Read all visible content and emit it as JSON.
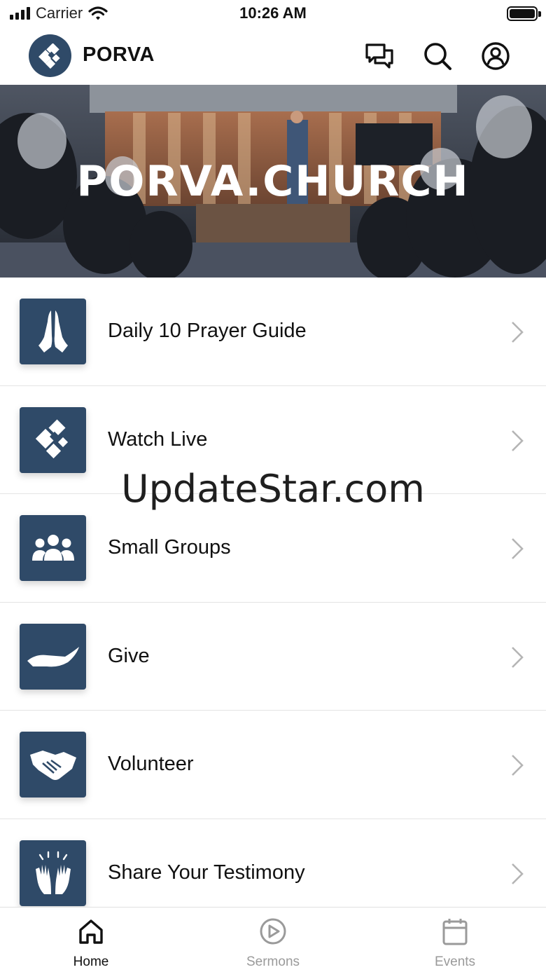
{
  "status": {
    "carrier": "Carrier",
    "time": "10:26 AM"
  },
  "header": {
    "title": "PORVA",
    "icons": [
      "chat-icon",
      "search-icon",
      "profile-icon"
    ]
  },
  "hero": {
    "title": "PORVA.CHURCH"
  },
  "menu": [
    {
      "label": "Daily 10 Prayer Guide",
      "icon": "praying-hands-icon"
    },
    {
      "label": "Watch Live",
      "icon": "porva-logo-icon"
    },
    {
      "label": "Small Groups",
      "icon": "group-icon"
    },
    {
      "label": "Give",
      "icon": "open-hand-icon"
    },
    {
      "label": "Volunteer",
      "icon": "handshake-icon"
    },
    {
      "label": "Share Your Testimony",
      "icon": "raised-hands-icon"
    }
  ],
  "watermark": "UpdateStar.com",
  "tabs": [
    {
      "label": "Home",
      "icon": "home-icon",
      "active": true
    },
    {
      "label": "Sermons",
      "icon": "play-icon",
      "active": false
    },
    {
      "label": "Events",
      "icon": "calendar-icon",
      "active": false
    }
  ],
  "colors": {
    "brand": "#2f4a68",
    "tab_active": "#111111",
    "tab_inactive": "#9a9a9a",
    "chevron": "#b5b5b5"
  }
}
